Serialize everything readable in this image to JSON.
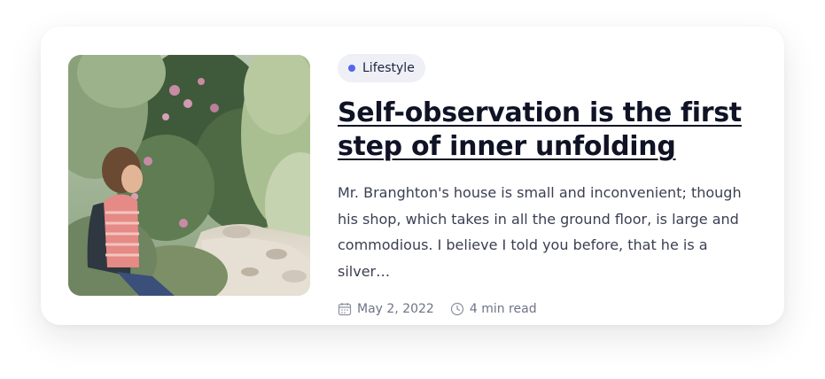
{
  "post": {
    "image_alt": "Child with backpack sitting by a forest trail",
    "category": {
      "label": "Lifestyle",
      "dot_color": "#5566ee"
    },
    "title": "Self-observation is the first step of inner unfolding",
    "excerpt": "Mr. Branghton's house is small and inconvenient; though his shop, which takes in all the ground floor, is large and commodious. I believe I told you before, that he is a silver…",
    "meta": {
      "date": "May 2, 2022",
      "date_icon": "calendar-icon",
      "read_time": "4 min read",
      "read_time_icon": "clock-icon"
    }
  },
  "colors": {
    "card_bg": "#ffffff",
    "tag_bg": "#eef0f6",
    "title": "#0f1325",
    "body_text": "#3a3f52",
    "meta_text": "#6e7387"
  }
}
